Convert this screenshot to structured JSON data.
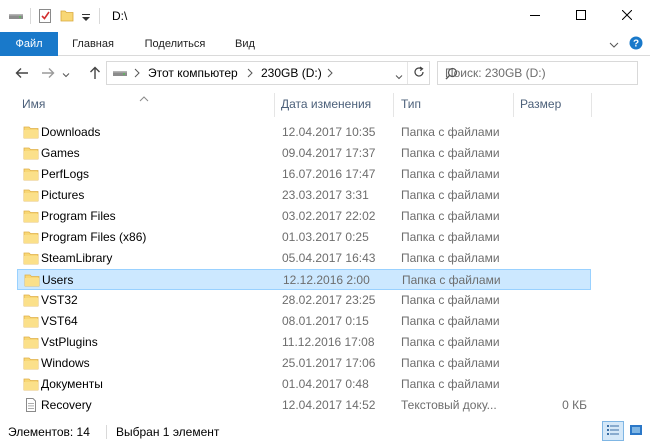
{
  "window": {
    "title": "D:\\"
  },
  "ribbon": {
    "tabs": [
      {
        "label": "Файл"
      },
      {
        "label": "Главная"
      },
      {
        "label": "Поделиться"
      },
      {
        "label": "Вид"
      }
    ]
  },
  "address": {
    "segments": [
      "Этот компьютер",
      "230GB (D:)"
    ]
  },
  "search": {
    "placeholder": "Поиск: 230GB (D:)"
  },
  "columns": {
    "name": "Имя",
    "date": "Дата изменения",
    "type": "Тип",
    "size": "Размер"
  },
  "files": [
    {
      "name": "Downloads",
      "date": "12.04.2017 10:35",
      "type": "Папка с файлами",
      "size": "",
      "icon": "folder-icon"
    },
    {
      "name": "Games",
      "date": "09.04.2017 17:37",
      "type": "Папка с файлами",
      "size": "",
      "icon": "folder-icon"
    },
    {
      "name": "PerfLogs",
      "date": "16.07.2016 17:47",
      "type": "Папка с файлами",
      "size": "",
      "icon": "folder-icon"
    },
    {
      "name": "Pictures",
      "date": "23.03.2017 3:31",
      "type": "Папка с файлами",
      "size": "",
      "icon": "folder-icon"
    },
    {
      "name": "Program Files",
      "date": "03.02.2017 22:02",
      "type": "Папка с файлами",
      "size": "",
      "icon": "folder-icon"
    },
    {
      "name": "Program Files (x86)",
      "date": "01.03.2017 0:25",
      "type": "Папка с файлами",
      "size": "",
      "icon": "folder-icon"
    },
    {
      "name": "SteamLibrary",
      "date": "05.04.2017 16:43",
      "type": "Папка с файлами",
      "size": "",
      "icon": "folder-icon"
    },
    {
      "name": "Users",
      "date": "12.12.2016 2:00",
      "type": "Папка с файлами",
      "size": "",
      "icon": "folder-icon"
    },
    {
      "name": "VST32",
      "date": "28.02.2017 23:25",
      "type": "Папка с файлами",
      "size": "",
      "icon": "folder-icon"
    },
    {
      "name": "VST64",
      "date": "08.01.2017 0:15",
      "type": "Папка с файлами",
      "size": "",
      "icon": "folder-icon"
    },
    {
      "name": "VstPlugins",
      "date": "11.12.2016 17:08",
      "type": "Папка с файлами",
      "size": "",
      "icon": "folder-icon"
    },
    {
      "name": "Windows",
      "date": "25.01.2017 17:06",
      "type": "Папка с файлами",
      "size": "",
      "icon": "folder-icon"
    },
    {
      "name": "Документы",
      "date": "01.04.2017 0:48",
      "type": "Папка с файлами",
      "size": "",
      "icon": "folder-icon"
    },
    {
      "name": "Recovery",
      "date": "12.04.2017 14:52",
      "type": "Текстовый доку...",
      "size": "0 КБ",
      "icon": "text-document-icon"
    }
  ],
  "selected_file": "Users",
  "status": {
    "count": "Элементов: 14",
    "selection": "Выбран 1 элемент"
  },
  "colors": {
    "file_tab": "#1979ca",
    "selection_fill": "#cce8ff",
    "selection_border": "#99d1ff",
    "folder_yellow": "#f8d775"
  }
}
